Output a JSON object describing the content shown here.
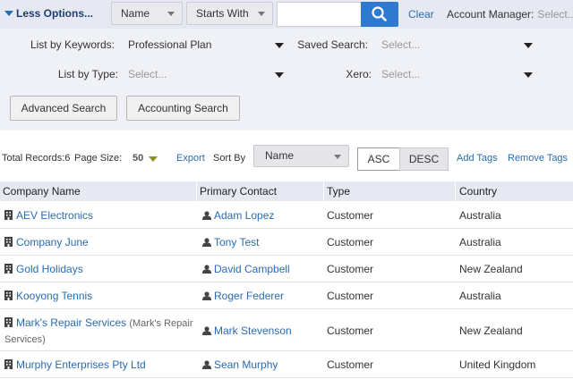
{
  "topbar": {
    "less_options": "Less Options...",
    "field_dropdown": "Name",
    "match_dropdown": "Starts With",
    "search_value": "",
    "clear": "Clear",
    "account_manager_label": "Account Manager:",
    "account_manager_placeholder": "Select..."
  },
  "filters": {
    "keywords_label": "List by Keywords:",
    "keywords_value": "Professional Plan",
    "saved_search_label": "Saved Search:",
    "saved_search_placeholder": "Select...",
    "type_label": "List by Type:",
    "type_placeholder": "Select...",
    "xero_label": "Xero:",
    "xero_placeholder": "Select...",
    "advanced_search": "Advanced Search",
    "accounting_search": "Accounting Search"
  },
  "toolbar": {
    "total_records": "Total Records:6",
    "page_size_label": "Page Size:",
    "page_size_value": "50",
    "export": "Export",
    "sort_by_label": "Sort By",
    "sort_by_value": "Name",
    "asc": "ASC",
    "desc": "DESC",
    "add_tags": "Add Tags",
    "remove_tags": "Remove Tags"
  },
  "table": {
    "headers": [
      "Company Name",
      "Primary Contact",
      "Type",
      "Country"
    ],
    "rows": [
      {
        "company": "AEV Electronics",
        "company_sub": "",
        "contact": "Adam Lopez",
        "type": "Customer",
        "country": "Australia"
      },
      {
        "company": "Company June",
        "company_sub": "",
        "contact": "Tony Test",
        "type": "Customer",
        "country": "Australia"
      },
      {
        "company": "Gold Holidays",
        "company_sub": "",
        "contact": "David Campbell",
        "type": "Customer",
        "country": "New Zealand"
      },
      {
        "company": "Kooyong Tennis",
        "company_sub": "",
        "contact": "Roger Federer",
        "type": "Customer",
        "country": "Australia"
      },
      {
        "company": "Mark's Repair Services",
        "company_sub": "(Mark's Repair Services)",
        "contact": "Mark Stevenson",
        "type": "Customer",
        "country": "New Zealand"
      },
      {
        "company": "Murphy Enterprises Pty Ltd",
        "company_sub": "",
        "contact": "Sean Murphy",
        "type": "Customer",
        "country": "United Kingdom"
      }
    ]
  },
  "colors": {
    "accent": "#2e7ad1",
    "link": "#2a6bb1",
    "header_bg": "#e6e9f1"
  }
}
